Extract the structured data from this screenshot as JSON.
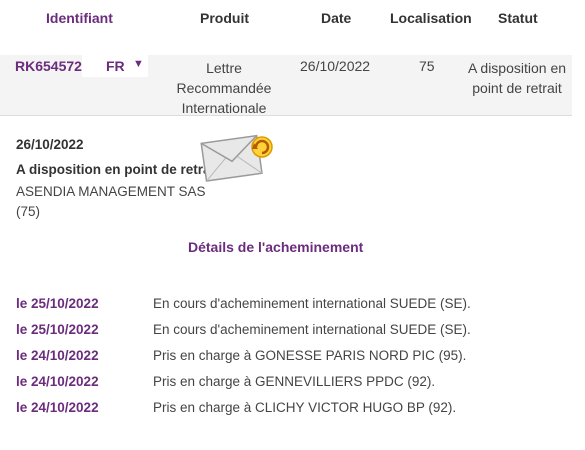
{
  "table": {
    "headers": {
      "id": "Identifiant",
      "product": "Produit",
      "date": "Date",
      "location": "Localisation",
      "status": "Statut"
    },
    "row": {
      "tracking_id": "RK654572",
      "country": "FR",
      "country_caret": "▼",
      "product": "Lettre Recommandée Internationale",
      "date": "26/10/2022",
      "location": "75",
      "status": "A disposition en point de retrait"
    }
  },
  "detail": {
    "date": "26/10/2022",
    "status": "A disposition en point de retrait",
    "company": "ASENDIA MANAGEMENT SAS",
    "zip": "(75)",
    "icon": "envelope-refresh-icon"
  },
  "routing": {
    "title": "Détails de l'acheminement",
    "events": [
      {
        "date": "le 25/10/2022",
        "text": "En cours d'acheminement international  SUEDE (SE)."
      },
      {
        "date": "le 25/10/2022",
        "text": "En cours d'acheminement international  SUEDE (SE)."
      },
      {
        "date": "le 24/10/2022",
        "text": "Pris en charge à GONESSE PARIS NORD PIC (95)."
      },
      {
        "date": "le 24/10/2022",
        "text": "Pris en charge à GENNEVILLIERS PPDC (92)."
      },
      {
        "date": "le 24/10/2022",
        "text": "Pris en charge à CLICHY VICTOR HUGO BP (92)."
      }
    ]
  },
  "colors": {
    "accent": "#6b2c7e",
    "row_background": "#f4f4f4",
    "icon_refresh": "#f0b400"
  }
}
